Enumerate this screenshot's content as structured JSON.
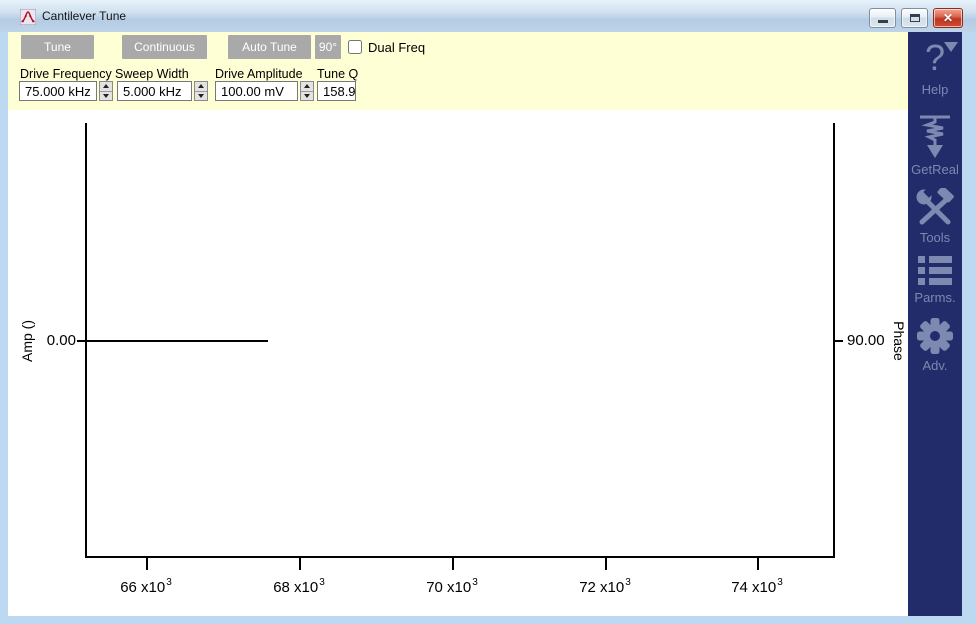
{
  "window": {
    "title": "Cantilever Tune",
    "icon": "resonance-curve-icon",
    "controls": {
      "minimize": "minimize-icon",
      "maximize": "maximize-icon",
      "close": "close-icon",
      "close_glyph": "✕"
    }
  },
  "toolbar": {
    "background": "#ffffd6",
    "buttons": [
      {
        "label": "Tune"
      },
      {
        "label": "Continuous"
      },
      {
        "label": "Auto Tune"
      },
      {
        "label": "90°"
      }
    ],
    "dual_freq": {
      "label": "Dual Freq",
      "checked": false
    },
    "fields": [
      {
        "label": "Drive Frequency",
        "value": "75.000 kHz",
        "spinner": true
      },
      {
        "label": "Sweep Width",
        "value": "5.000 kHz",
        "spinner": true
      },
      {
        "label": "Drive Amplitude",
        "value": "100.00 mV",
        "spinner": true
      },
      {
        "label": "Tune Q",
        "value": "158.9",
        "spinner": false
      }
    ]
  },
  "sidebar": {
    "background": "#222c6a",
    "icon_color": "#7e89b1",
    "items": [
      {
        "label": "Help",
        "icon": "help-question-icon"
      },
      {
        "label": "GetReal",
        "icon": "spring-arrow-icon"
      },
      {
        "label": "Tools",
        "icon": "crossed-tools-icon"
      },
      {
        "label": "Parms.",
        "icon": "bullet-list-icon"
      },
      {
        "label": "Adv.",
        "icon": "gear-icon"
      }
    ]
  },
  "plot": {
    "left_axis_label": "Amp ()",
    "left_tick_label": "0.00",
    "right_axis_label": "Phase",
    "right_tick_label": "90.00",
    "x_ticks": [
      {
        "base": "66 x10",
        "exp": "3"
      },
      {
        "base": "68 x10",
        "exp": "3"
      },
      {
        "base": "70 x10",
        "exp": "3"
      },
      {
        "base": "72 x10",
        "exp": "3"
      },
      {
        "base": "74 x10",
        "exp": "3"
      }
    ]
  },
  "chart_data": {
    "type": "line",
    "title": "",
    "xlabel": "",
    "ylabel_left": "Amp ()",
    "ylabel_right": "Phase",
    "x_tick_values": [
      66000,
      68000,
      70000,
      72000,
      74000
    ],
    "xlim": [
      65200,
      75000
    ],
    "y_left_ticks": [
      0.0
    ],
    "y_right_ticks": [
      90.0
    ],
    "grid": false,
    "legend": "none",
    "series": [
      {
        "name": "Amplitude",
        "x": [
          65200,
          67600
        ],
        "y": [
          0,
          0
        ]
      }
    ]
  }
}
